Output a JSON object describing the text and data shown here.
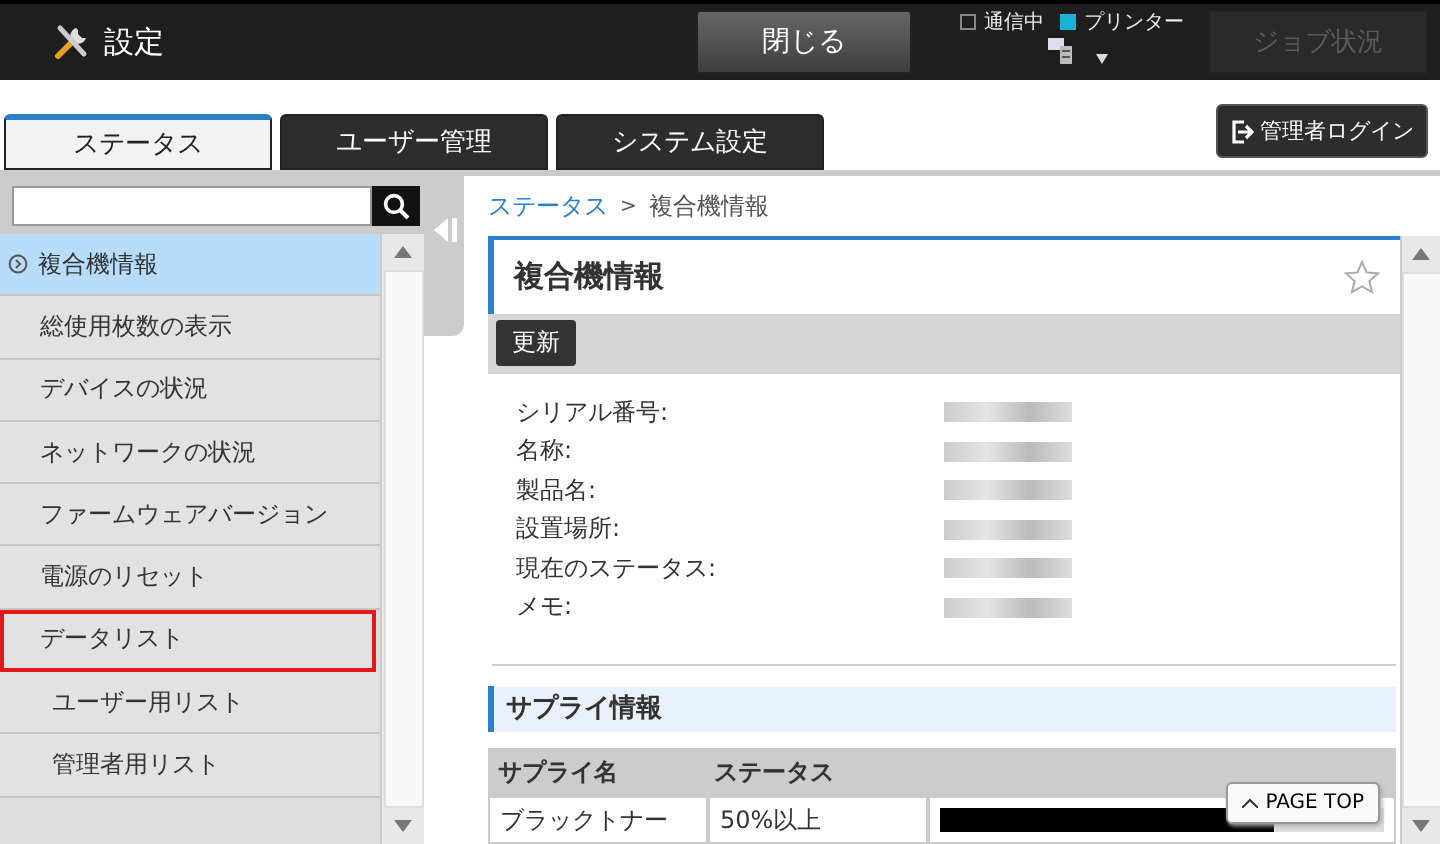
{
  "header": {
    "title": "設定",
    "close_button": "閉じる",
    "indicators": [
      {
        "label": "通信中",
        "on": false
      },
      {
        "label": "プリンター",
        "on": true
      }
    ],
    "job_status": {
      "label": "ジョブ状況",
      "disabled": true
    }
  },
  "tabs": [
    {
      "label": "ステータス",
      "selected": true
    },
    {
      "label": "ユーザー管理",
      "selected": false
    },
    {
      "label": "システム設定",
      "selected": false
    }
  ],
  "admin_login": "管理者ログイン",
  "sidebar": {
    "items": [
      {
        "label": "複合機情報",
        "selected": true,
        "highlighted": false
      },
      {
        "label": "総使用枚数の表示",
        "selected": false,
        "highlighted": false
      },
      {
        "label": "デバイスの状況",
        "selected": false,
        "highlighted": false
      },
      {
        "label": "ネットワークの状況",
        "selected": false,
        "highlighted": false
      },
      {
        "label": "ファームウェアバージョン",
        "selected": false,
        "highlighted": false
      },
      {
        "label": "電源のリセット",
        "selected": false,
        "highlighted": false
      },
      {
        "label": "データリスト",
        "selected": false,
        "highlighted": true,
        "children": [
          {
            "label": "ユーザー用リスト",
            "selected": false,
            "highlighted": false
          },
          {
            "label": "管理者用リスト",
            "selected": false,
            "highlighted": false
          }
        ]
      }
    ]
  },
  "breadcrumb": {
    "link": "ステータス",
    "separator": ">",
    "current": "複合機情報"
  },
  "panel": {
    "title": "複合機情報",
    "favorite": false,
    "refresh_button": "更新",
    "fields": [
      "シリアル番号:",
      "名称:",
      "製品名:",
      "設置場所:",
      "現在のステータス:",
      "メモ:"
    ],
    "supply_section": {
      "title": "サプライ情報",
      "columns": [
        "サプライ名",
        "ステータス"
      ],
      "rows": [
        {
          "name": "ブラックトナー",
          "status": "50%以上",
          "level": 0.75
        }
      ]
    }
  },
  "page_top": "PAGE TOP"
}
